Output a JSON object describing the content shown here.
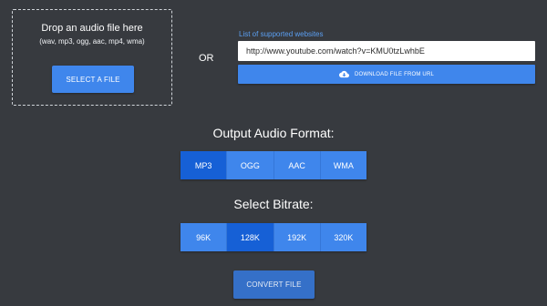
{
  "dropzone": {
    "title": "Drop an audio file here",
    "formats": "(wav, mp3, ogg, aac, mp4, wma)",
    "select_button": "SELECT A FILE"
  },
  "separator": {
    "or": "OR"
  },
  "url_section": {
    "supported_link": "List of supported websites",
    "url_value": "http://www.youtube.com/watch?v=KMU0tzLwhbE",
    "download_button": "DOWNLOAD FILE FROM URL",
    "download_icon": "cloud-download-icon"
  },
  "format_section": {
    "title": "Output Audio Format:",
    "options": [
      "MP3",
      "OGG",
      "AAC",
      "WMA"
    ],
    "selected": "MP3"
  },
  "bitrate_section": {
    "title": "Select Bitrate:",
    "options": [
      "96K",
      "128K",
      "192K",
      "320K"
    ],
    "selected": "128K"
  },
  "convert_button": "CONVERT FILE",
  "colors": {
    "background": "#373a3f",
    "accent": "#3f86ec",
    "accent_active": "#1660d6",
    "link": "#5b9ff2"
  }
}
